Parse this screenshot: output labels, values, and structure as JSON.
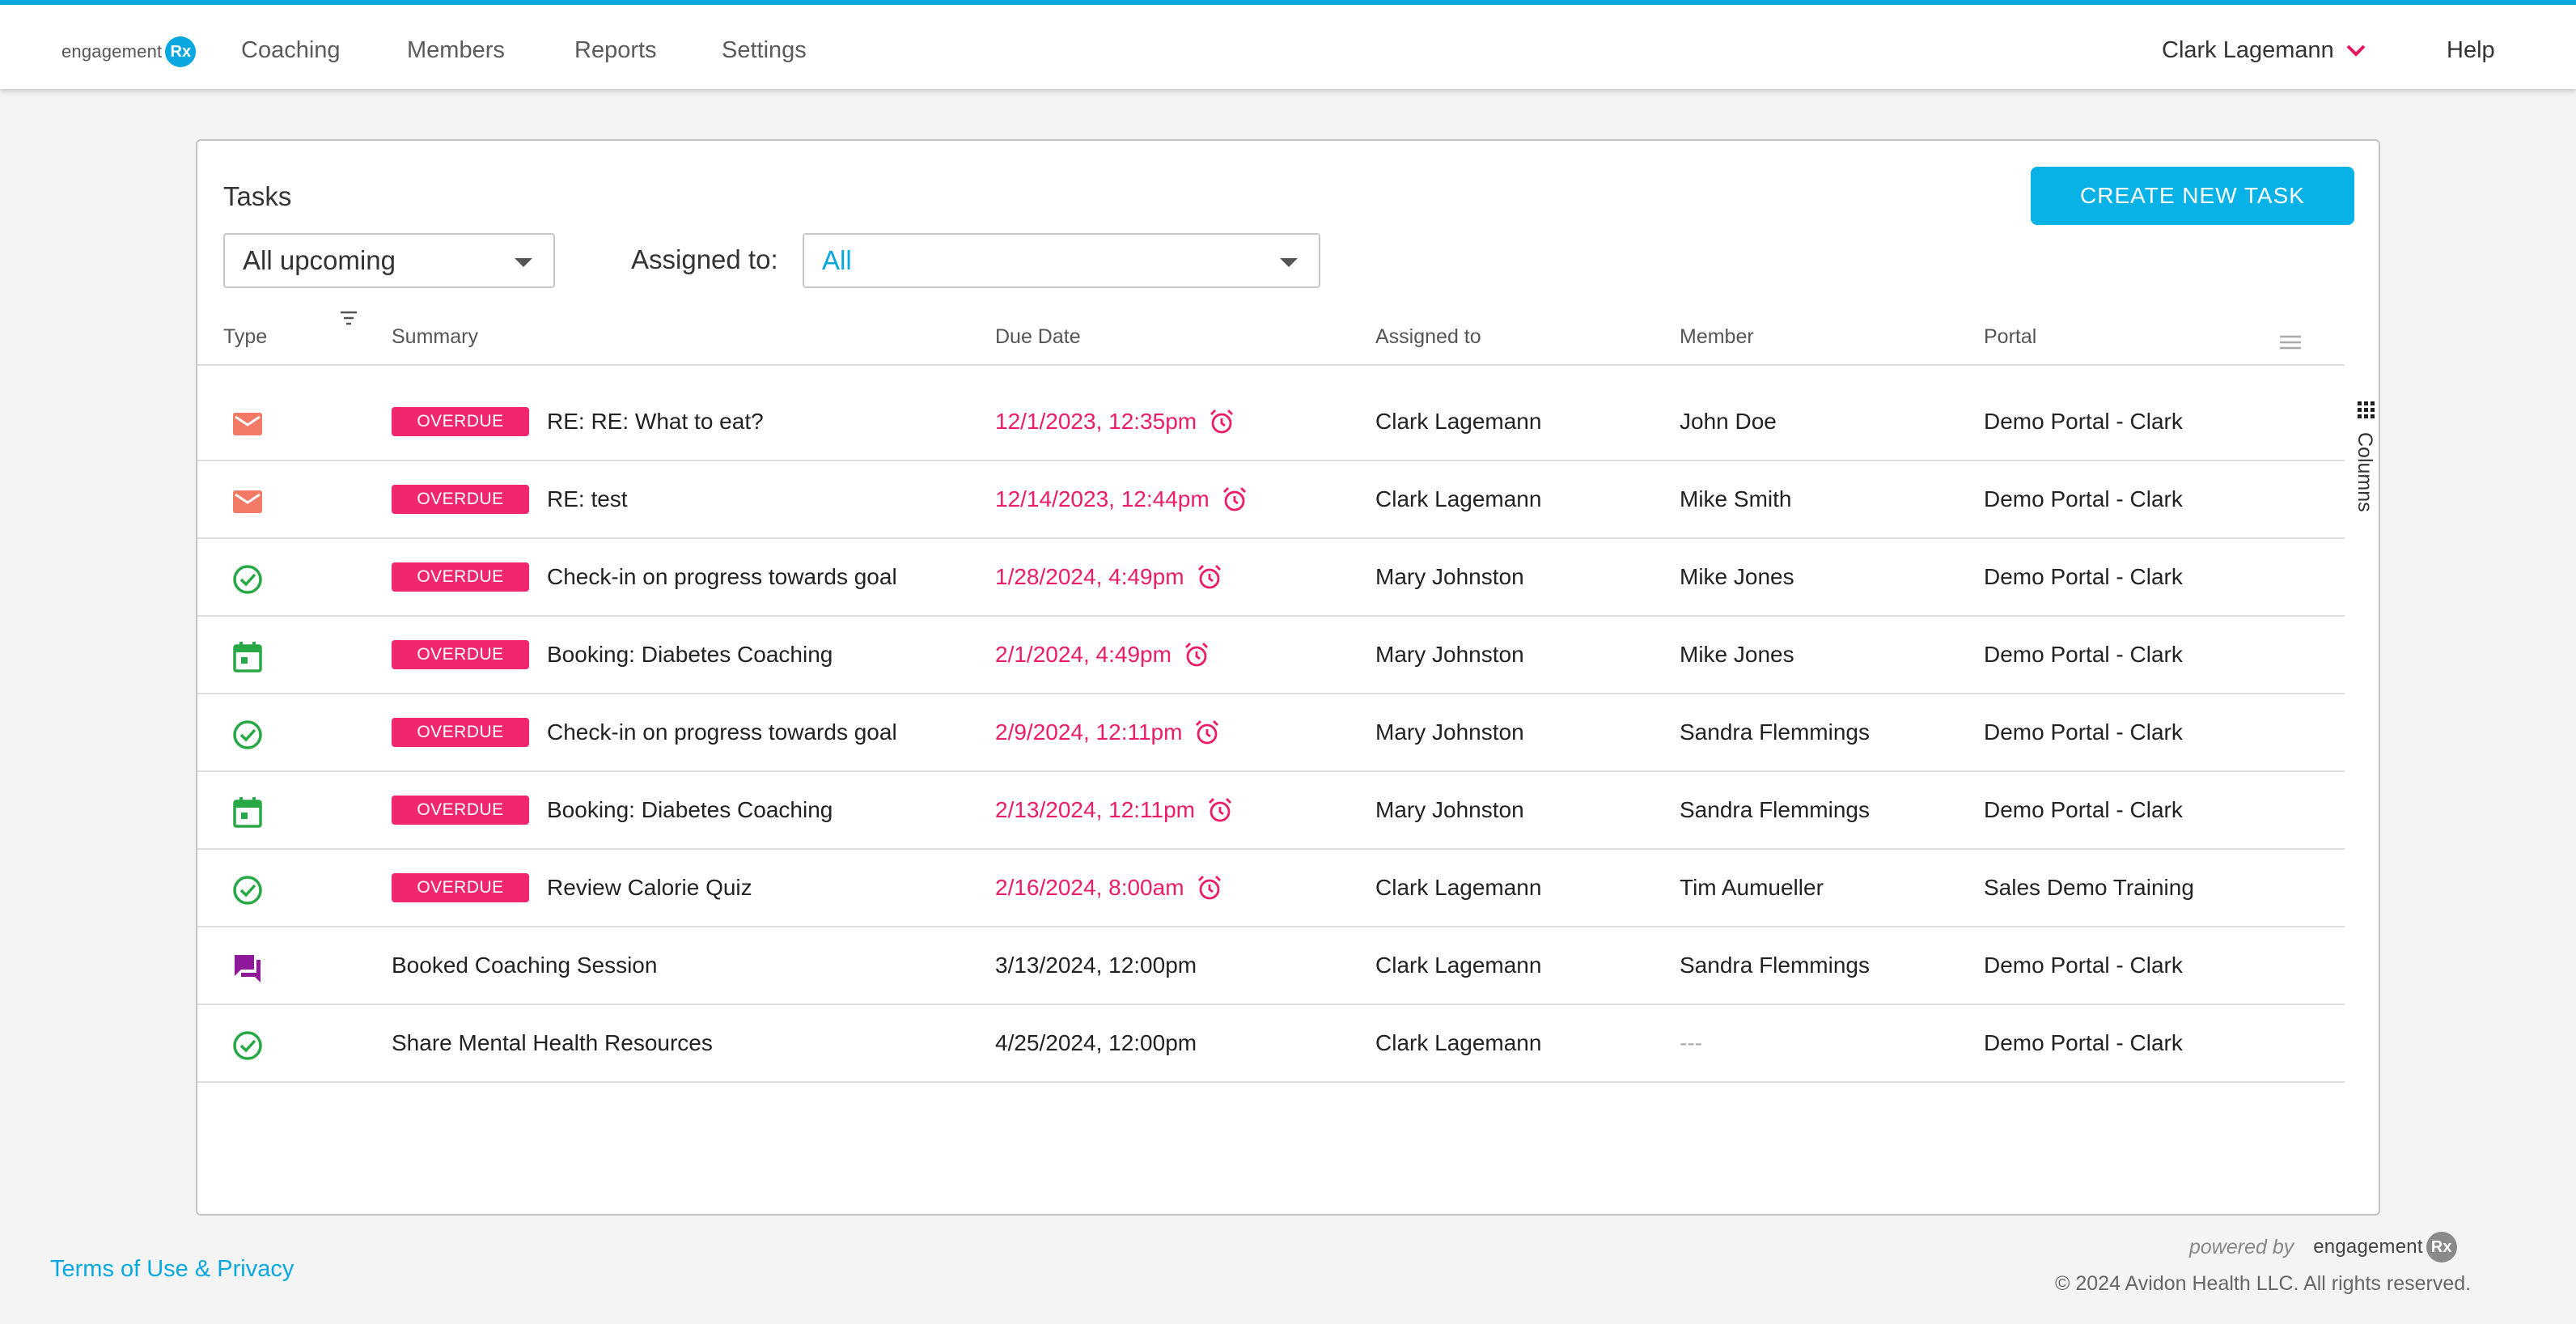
{
  "colors": {
    "accent": "#08a7e0",
    "overdue": "#f0266e",
    "icon_green": "#27a844",
    "icon_mail": "#f27a66",
    "icon_chat": "#8e1a9b"
  },
  "brand": {
    "logo_text": "engagement",
    "logo_badge": "Rx"
  },
  "nav": {
    "items": [
      "Coaching",
      "Members",
      "Reports",
      "Settings"
    ],
    "user_name": "Clark Lagemann",
    "help": "Help"
  },
  "tasks": {
    "title": "Tasks",
    "create_button": "CREATE NEW TASK",
    "filter_value": "All upcoming",
    "assigned_label": "Assigned to:",
    "assigned_value": "All",
    "columns_label": "Columns",
    "headers": {
      "type": "Type",
      "summary": "Summary",
      "due": "Due Date",
      "assigned": "Assigned to",
      "member": "Member",
      "portal": "Portal"
    },
    "rows": [
      {
        "type_icon": "mail-icon",
        "overdue": true,
        "badge": "OVERDUE",
        "summary": "RE: RE: What to eat?",
        "due": "12/1/2023, 12:35pm",
        "assigned": "Clark Lagemann",
        "member": "John Doe",
        "portal": "Demo Portal - Clark"
      },
      {
        "type_icon": "mail-icon",
        "overdue": true,
        "badge": "OVERDUE",
        "summary": "RE: test",
        "due": "12/14/2023, 12:44pm",
        "assigned": "Clark Lagemann",
        "member": "Mike Smith",
        "portal": "Demo Portal - Clark"
      },
      {
        "type_icon": "check-circle-icon",
        "overdue": true,
        "badge": "OVERDUE",
        "summary": "Check-in on progress towards goal",
        "due": "1/28/2024, 4:49pm",
        "assigned": "Mary Johnston",
        "member": "Mike Jones",
        "portal": "Demo Portal - Clark"
      },
      {
        "type_icon": "calendar-icon",
        "overdue": true,
        "badge": "OVERDUE",
        "summary": "Booking: Diabetes Coaching",
        "due": "2/1/2024, 4:49pm",
        "assigned": "Mary Johnston",
        "member": "Mike Jones",
        "portal": "Demo Portal - Clark"
      },
      {
        "type_icon": "check-circle-icon",
        "overdue": true,
        "badge": "OVERDUE",
        "summary": "Check-in on progress towards goal",
        "due": "2/9/2024, 12:11pm",
        "assigned": "Mary Johnston",
        "member": "Sandra Flemmings",
        "portal": "Demo Portal - Clark"
      },
      {
        "type_icon": "calendar-icon",
        "overdue": true,
        "badge": "OVERDUE",
        "summary": "Booking: Diabetes Coaching",
        "due": "2/13/2024, 12:11pm",
        "assigned": "Mary Johnston",
        "member": "Sandra Flemmings",
        "portal": "Demo Portal - Clark"
      },
      {
        "type_icon": "check-circle-icon",
        "overdue": true,
        "badge": "OVERDUE",
        "summary": "Review Calorie Quiz",
        "due": "2/16/2024, 8:00am",
        "assigned": "Clark Lagemann",
        "member": "Tim Aumueller",
        "portal": "Sales Demo Training"
      },
      {
        "type_icon": "chat-icon",
        "overdue": false,
        "badge": "",
        "summary": "Booked Coaching Session",
        "due": "3/13/2024, 12:00pm",
        "assigned": "Clark Lagemann",
        "member": "Sandra Flemmings",
        "portal": "Demo Portal - Clark"
      },
      {
        "type_icon": "check-circle-icon",
        "overdue": false,
        "badge": "",
        "summary": "Share Mental Health Resources",
        "due": "4/25/2024, 12:00pm",
        "assigned": "Clark Lagemann",
        "member": "---",
        "portal": "Demo Portal - Clark"
      }
    ]
  },
  "footer": {
    "terms": "Terms of Use & Privacy",
    "powered_by": "powered by",
    "copyright": "© 2024 Avidon Health LLC. All rights reserved."
  }
}
